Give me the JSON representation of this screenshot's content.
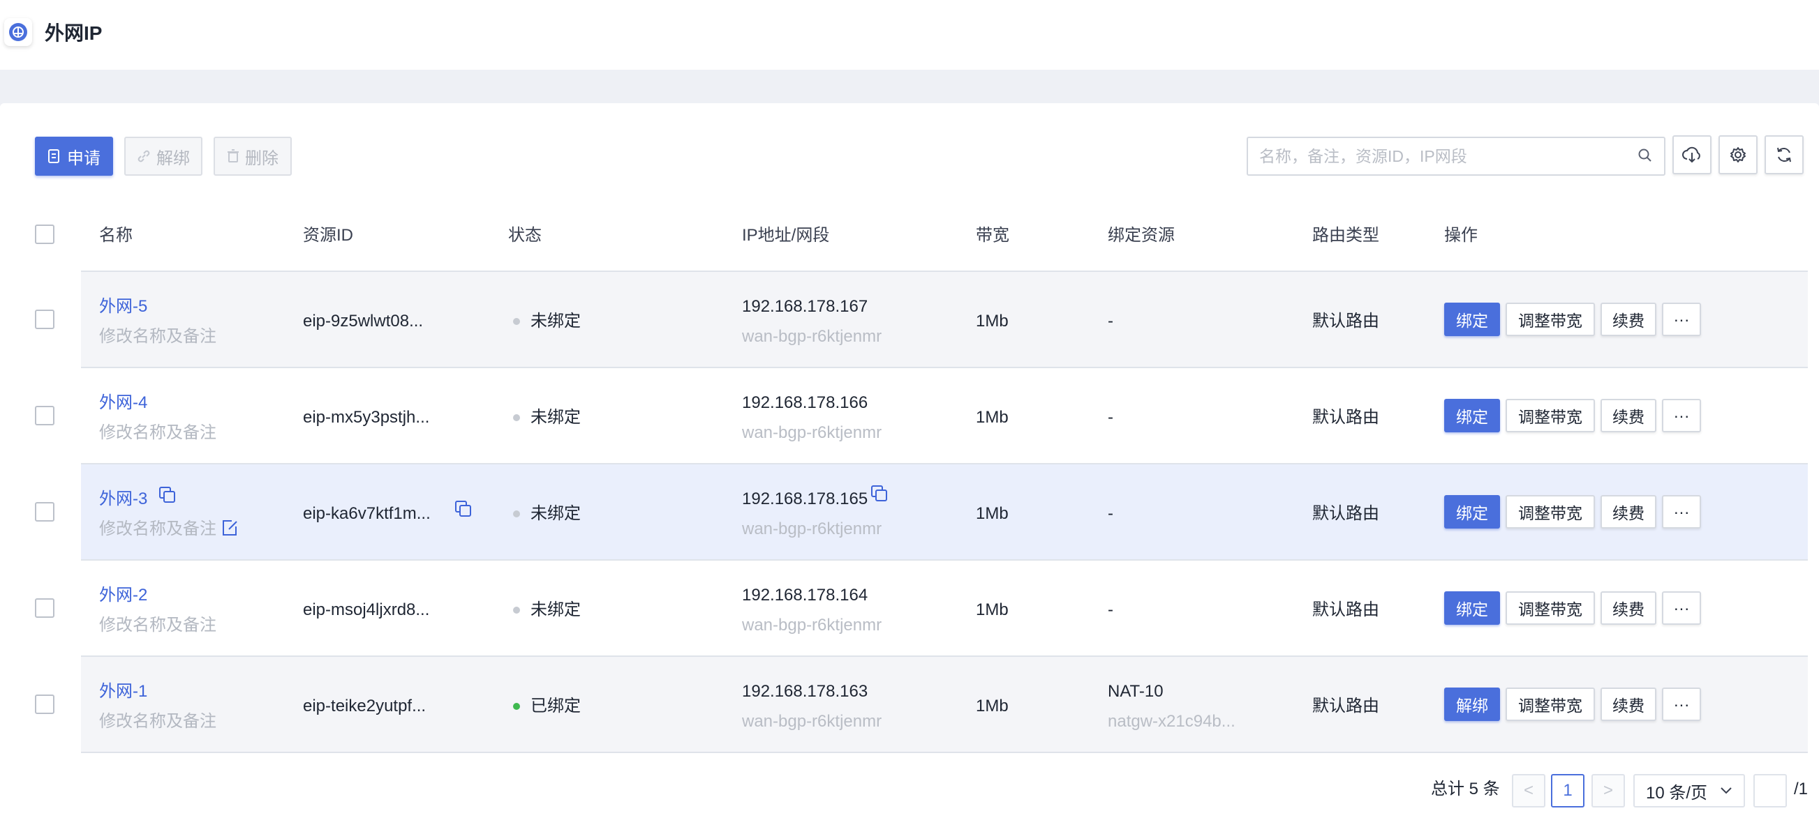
{
  "header": {
    "title": "外网IP",
    "app_icon": "network-globe-icon"
  },
  "toolbar": {
    "apply_label": "申请",
    "unbind_label": "解绑",
    "delete_label": "删除",
    "search_placeholder": "名称，备注，资源ID，IP网段",
    "icons": [
      "cloud-download-icon",
      "gear-icon",
      "refresh-icon"
    ]
  },
  "table": {
    "headers": {
      "name": "名称",
      "resource_id": "资源ID",
      "status": "状态",
      "ip": "IP地址/网段",
      "bandwidth": "带宽",
      "bound_resource": "绑定资源",
      "route_type": "路由类型",
      "actions": "操作"
    },
    "rows": [
      {
        "name": "外网-5",
        "remark": "修改名称及备注",
        "resource_id": "eip-9z5wlwt08...",
        "status": "未绑定",
        "status_color": "#c7cbd2",
        "ip": "192.168.178.167",
        "line": "wan-bgp-r6ktjenmr",
        "bandwidth": "1Mb",
        "bound": "-",
        "bound_sub": "",
        "route": "默认路由",
        "primary_action": "绑定",
        "resize_action": "调整带宽",
        "renew_action": "续费",
        "more_action": "···"
      },
      {
        "name": "外网-4",
        "remark": "修改名称及备注",
        "resource_id": "eip-mx5y3pstjh...",
        "status": "未绑定",
        "status_color": "#c7cbd2",
        "ip": "192.168.178.166",
        "line": "wan-bgp-r6ktjenmr",
        "bandwidth": "1Mb",
        "bound": "-",
        "bound_sub": "",
        "route": "默认路由",
        "primary_action": "绑定",
        "resize_action": "调整带宽",
        "renew_action": "续费",
        "more_action": "···"
      },
      {
        "name": "外网-3",
        "remark": "修改名称及备注",
        "resource_id": "eip-ka6v7ktf1m...",
        "status": "未绑定",
        "status_color": "#c7cbd2",
        "ip": "192.168.178.165",
        "line": "wan-bgp-r6ktjenmr",
        "bandwidth": "1Mb",
        "bound": "-",
        "bound_sub": "",
        "route": "默认路由",
        "primary_action": "绑定",
        "resize_action": "调整带宽",
        "renew_action": "续费",
        "more_action": "···"
      },
      {
        "name": "外网-2",
        "remark": "修改名称及备注",
        "resource_id": "eip-msoj4ljxrd8...",
        "status": "未绑定",
        "status_color": "#c7cbd2",
        "ip": "192.168.178.164",
        "line": "wan-bgp-r6ktjenmr",
        "bandwidth": "1Mb",
        "bound": "-",
        "bound_sub": "",
        "route": "默认路由",
        "primary_action": "绑定",
        "resize_action": "调整带宽",
        "renew_action": "续费",
        "more_action": "···"
      },
      {
        "name": "外网-1",
        "remark": "修改名称及备注",
        "resource_id": "eip-teike2yutpf...",
        "status": "已绑定",
        "status_color": "#3fb950",
        "ip": "192.168.178.163",
        "line": "wan-bgp-r6ktjenmr",
        "bandwidth": "1Mb",
        "bound": "NAT-10",
        "bound_sub": "natgw-x21c94b...",
        "route": "默认路由",
        "primary_action": "解绑",
        "resize_action": "调整带宽",
        "renew_action": "续费",
        "more_action": "···"
      }
    ]
  },
  "pagination": {
    "total_text": "总计 5 条",
    "prev": "<",
    "current_page": "1",
    "next": ">",
    "page_size": "10 条/页",
    "jump_value": "",
    "total_pages": "/1"
  },
  "colors": {
    "accent": "#4a6fdc",
    "link": "#3d63d9",
    "bound_dot": "#3fb950",
    "unbound_dot": "#c7cbd2"
  }
}
